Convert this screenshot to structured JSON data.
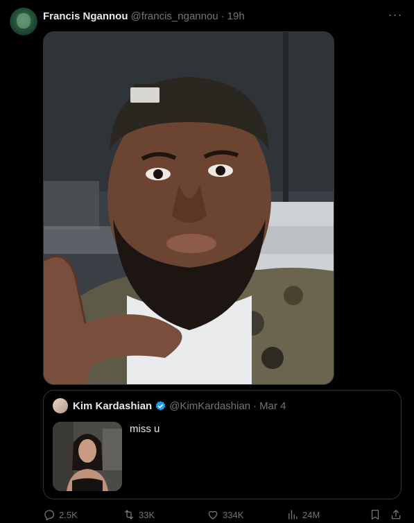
{
  "tweet": {
    "display_name": "Francis Ngannou",
    "handle": "@francis_ngannou",
    "separator": "·",
    "time": "19h",
    "more_label": "···",
    "avatar_icon": "profile-avatar"
  },
  "quote": {
    "display_name": "Kim Kardashian",
    "verified_icon": "verified-badge-icon",
    "verified_color": "#1d9bf0",
    "handle": "@KimKardashian",
    "separator": "·",
    "date": "Mar 4",
    "text": "miss u"
  },
  "actions": {
    "replies": "2.5K",
    "retweets": "33K",
    "likes": "334K",
    "views": "24M",
    "icons": [
      "reply-icon",
      "retweet-icon",
      "like-icon",
      "views-icon",
      "bookmark-icon",
      "share-icon"
    ]
  },
  "colors": {
    "background": "#000000",
    "text": "#e7e9ea",
    "muted": "#71767b",
    "border": "#2f3336"
  }
}
